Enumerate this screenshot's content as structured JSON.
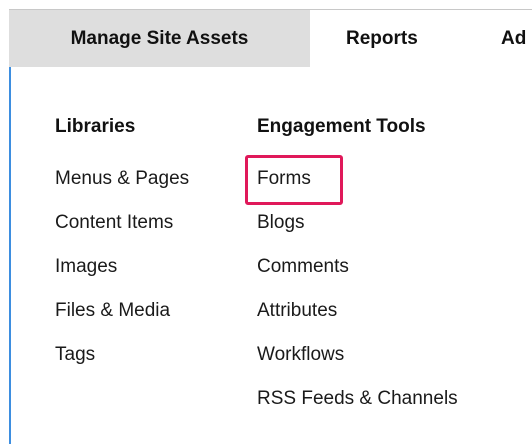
{
  "tabs": [
    {
      "label": "Manage Site Assets",
      "active": true
    },
    {
      "label": "Reports",
      "active": false
    },
    {
      "label": "Ad",
      "active": false
    }
  ],
  "menu": {
    "columns": [
      {
        "header": "Libraries",
        "items": [
          "Menus & Pages",
          "Content Items",
          "Images",
          "Files & Media",
          "Tags"
        ]
      },
      {
        "header": "Engagement Tools",
        "items": [
          "Forms",
          "Blogs",
          "Comments",
          "Attributes",
          "Workflows",
          "RSS Feeds & Channels"
        ]
      }
    ]
  },
  "highlighted_item": "Forms",
  "colors": {
    "active_tab_bg": "#dedede",
    "panel_border": "#3d8ee0",
    "highlight_border": "#e0185a"
  }
}
